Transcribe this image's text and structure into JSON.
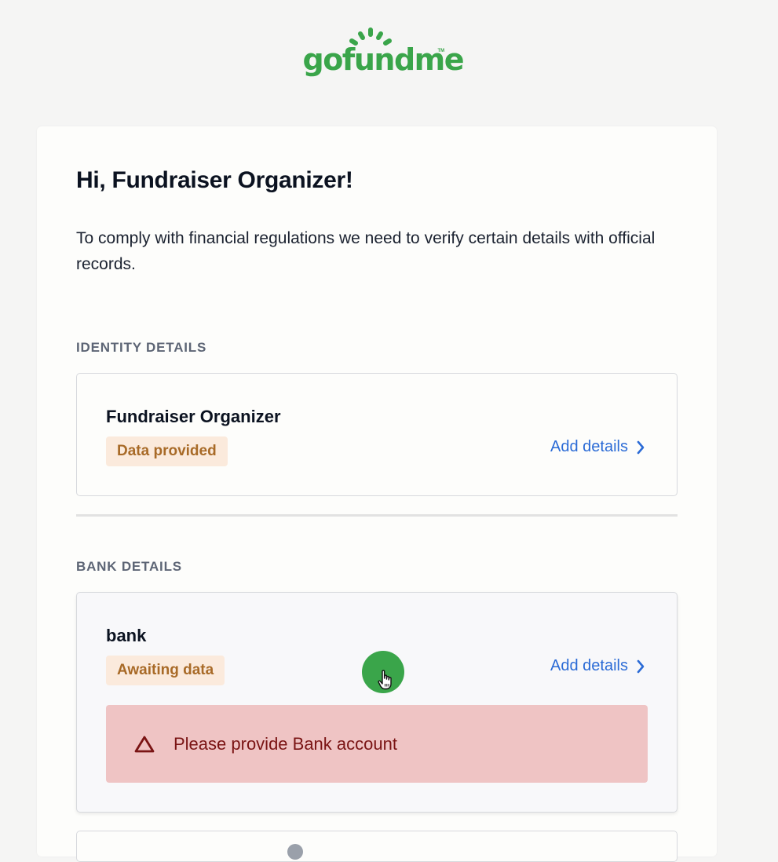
{
  "brand": {
    "logo_text": "gofundme",
    "trademark": "TM",
    "color": "#3aa54a"
  },
  "greeting": "Hi, Fundraiser Organizer!",
  "intro": "To comply with financial regulations we need to verify certain details with official records.",
  "identity": {
    "section_title": "IDENTITY DETAILS",
    "name": "Fundraiser Organizer",
    "status": "Data provided",
    "action": "Add details"
  },
  "bank": {
    "section_title": "BANK DETAILS",
    "name": "bank",
    "status": "Awaiting data",
    "action": "Add details",
    "alert": {
      "icon": "warning-triangle-icon",
      "text": "Please provide Bank account"
    }
  },
  "colors": {
    "link": "#2b6bd6",
    "badge_bg": "#fbeadc",
    "badge_text": "#a86a27",
    "alert_bg": "#efc4c4",
    "alert_text": "#7a1414"
  }
}
